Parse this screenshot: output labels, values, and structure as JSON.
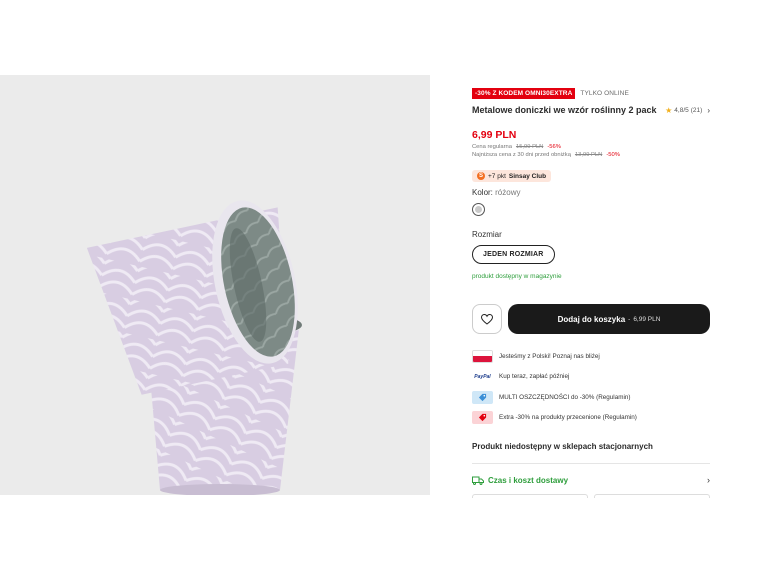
{
  "product": {
    "promo_badge": "-30% Z KODEM OMNI30EXTRA",
    "online_badge": "TYLKO ONLINE",
    "title": "Metalowe doniczki we wzór roślinny 2 pack",
    "rating": "4,8/5",
    "rating_count": "(21)",
    "price": "6,99 PLN",
    "regular_label": "Cena regularna",
    "regular_price": "15,99 PLN",
    "regular_discount": "-56%",
    "lowest_label": "Najniższa cena z 30 dni przed obniżką",
    "lowest_price": "13,99 PLN",
    "lowest_discount": "-50%",
    "club_text": "+7 pkt",
    "club_name": "Sinsay Club",
    "color_label": "Kolor:",
    "color_value": "różowy",
    "size_label": "Rozmiar",
    "size_option": "JEDEN ROZMIAR",
    "availability": "produkt dostępny w magazynie",
    "add_to_cart": "Dodaj do koszyka",
    "cart_separator": "-",
    "cart_price": "6,99 PLN",
    "unavailable_in_stores": "Produkt niedostępny w sklepach stacjonarnych",
    "delivery": "Czas i koszt dostawy"
  },
  "info_items": [
    {
      "icon": "poland-flag-icon",
      "text": "Jesteśmy z Polski! Poznaj nas bliżej"
    },
    {
      "icon": "paypal-icon",
      "icon_text": "PayPal",
      "text": "Kup teraz, zapłać później"
    },
    {
      "icon": "multi-savings-icon",
      "text": "MULTI OSZCZĘDNOŚCI do -30% (Regulamin)"
    },
    {
      "icon": "extra-discount-icon",
      "text": "Extra -30% na produkty przecenione (Regulamin)"
    }
  ],
  "colors": {
    "accent_red": "#e3000f",
    "success_green": "#2e9e3c",
    "button_dark": "#1a1a1a",
    "pot_lilac": "#d9cfe0"
  }
}
